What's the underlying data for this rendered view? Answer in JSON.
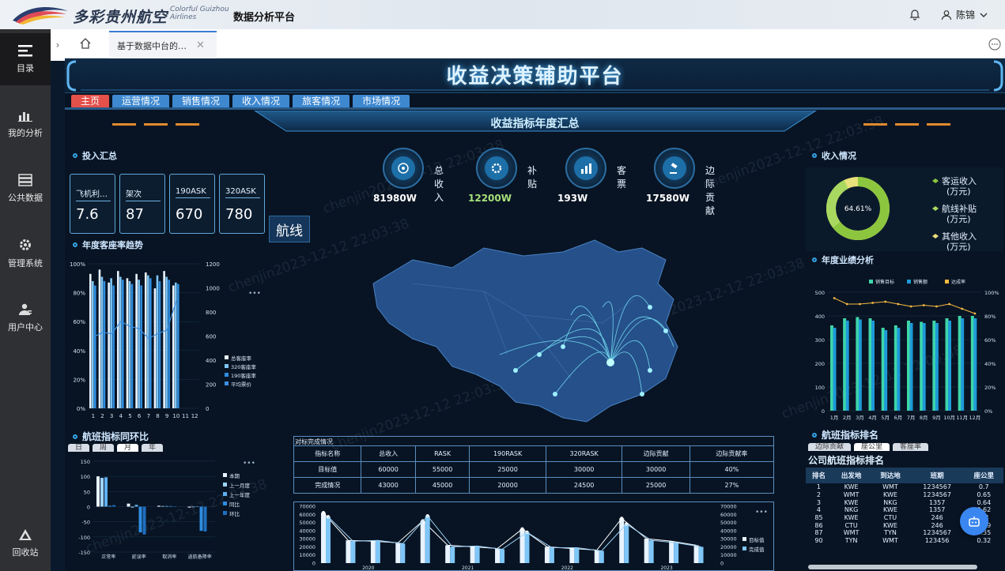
{
  "topbar": {
    "brand_cn": "多彩贵州航空",
    "brand_en_1": "Colorful Guizhou",
    "brand_en_2": "Airlines",
    "app_title": "数据分析平台",
    "user_name": "陈锦"
  },
  "sidebar": {
    "items": [
      {
        "label": "目录",
        "icon": "menu-list-icon"
      },
      {
        "label": "我的分析",
        "icon": "bar-chart-icon"
      },
      {
        "label": "公共数据",
        "icon": "database-icon"
      },
      {
        "label": "管理系统",
        "icon": "gear-icon"
      },
      {
        "label": "用户中心",
        "icon": "user-icon"
      },
      {
        "label": "回收站",
        "icon": "recycle-icon"
      }
    ]
  },
  "tabs": {
    "page_tab": "基于数据中台的…"
  },
  "dashboard": {
    "title": "收益决策辅助平台",
    "nav": [
      "主页",
      "运营情况",
      "销售情况",
      "收入情况",
      "旅客情况",
      "市场情况"
    ],
    "banner": "收益指标年度汇总",
    "watermark": "chenjin2023-12-12 22:03:38",
    "investment": {
      "title": "投入汇总",
      "cards": [
        {
          "label": "飞机利…",
          "value": "7.6"
        },
        {
          "label": "架次",
          "value": "87"
        },
        {
          "label": "190ASK",
          "value": "670"
        },
        {
          "label": "320ASK",
          "value": "780"
        }
      ]
    },
    "indicators": [
      {
        "label": "总收入",
        "value": "81980W"
      },
      {
        "label": "补贴",
        "value": "12200W"
      },
      {
        "label": "客票",
        "value": "193W"
      },
      {
        "label": "边际贡献",
        "value": "17580W"
      }
    ],
    "route_label": "航线",
    "income": {
      "title": "收入情况",
      "pct": "64.61%",
      "legend": [
        "客运收入",
        "(万元)",
        "航线补贴",
        "(万元)",
        "其他收入",
        "(万元)"
      ],
      "share": 0.6461
    },
    "load_trend": {
      "title": "年度客座率趋势",
      "legend": [
        "总客座率",
        "320客座率",
        "190客座率",
        "平均票价"
      ],
      "y_left": [
        "100%",
        "80%",
        "60%",
        "40%",
        "20%",
        "0%"
      ],
      "y_right": [
        "1200",
        "1000",
        "800",
        "600",
        "400",
        "200",
        "0"
      ],
      "x": [
        "1",
        "2",
        "3",
        "4",
        "5",
        "6",
        "7",
        "8",
        "9",
        "10",
        "11",
        "12"
      ]
    },
    "flight_yoy": {
      "title": "航班指标同环比",
      "tabs": [
        "日",
        "周",
        "月",
        "年"
      ],
      "y": [
        "150",
        "100",
        "50",
        "0",
        "-50",
        "-100",
        "-150"
      ],
      "x": [
        "正常率",
        "延误率",
        "取消率",
        "返航备降率"
      ],
      "legend": [
        "本期",
        "上一月度",
        "上一年度",
        "同比",
        "环比"
      ]
    },
    "completion": {
      "caption": "对标完成情况",
      "headers": [
        "指标名称",
        "总收入",
        "RASK",
        "190RASK",
        "320RASK",
        "边际贡献",
        "边际贡献率"
      ],
      "rows": [
        [
          "目标值",
          "60000",
          "55000",
          "25000",
          "30000",
          "30000",
          "40%"
        ],
        [
          "完成情况",
          "43000",
          "45000",
          "20000",
          "24500",
          "25000",
          "27%"
        ]
      ]
    },
    "combo": {
      "y_left": [
        "70000",
        "60000",
        "50000",
        "40000",
        "30000",
        "20000",
        "10000",
        "0"
      ],
      "y_right": [
        "70000",
        "60000",
        "50000",
        "40000",
        "30000",
        "20000",
        "10000",
        "0"
      ],
      "x": [
        "2020",
        "2021",
        "2022",
        "2023"
      ],
      "legend": [
        "目标值",
        "完成值"
      ]
    },
    "annual": {
      "title": "年度业绩分析",
      "legend": [
        "销售目标",
        "销售额",
        "达成率"
      ],
      "y_left": [
        "500",
        "400",
        "300",
        "200",
        "100",
        "0"
      ],
      "y_right": [
        "100%",
        "80%",
        "60%",
        "40%",
        "20%",
        "0%"
      ],
      "x": [
        "1月",
        "2月",
        "3月",
        "4月",
        "5月",
        "6月",
        "7月",
        "8月",
        "9月",
        "10月",
        "11月",
        "12月"
      ]
    },
    "ranking": {
      "title": "航班指标排名",
      "tabs": [
        "边际贡献",
        "座公里",
        "客座率"
      ],
      "subtitle": "公司航班指标排名",
      "headers": [
        "排名",
        "出发地",
        "到达地",
        "班期",
        "座公里"
      ],
      "rows": [
        [
          "1",
          "KWE",
          "WMT",
          "1234567",
          "0.7"
        ],
        [
          "2",
          "WMT",
          "KWE",
          "1234567",
          "0.65"
        ],
        [
          "3",
          "KWE",
          "NKG",
          "1357",
          "0.64"
        ],
        [
          "4",
          "NKG",
          "KWE",
          "1357",
          "0.62"
        ],
        [
          "85",
          "KWE",
          "CTU",
          "246",
          "0.4"
        ],
        [
          "86",
          "CTU",
          "KWE",
          "246",
          "0.39"
        ],
        [
          "87",
          "WMT",
          "TYN",
          "1234567",
          "0.35"
        ],
        [
          "90",
          "TYN",
          "WMT",
          "123456",
          "0.32"
        ]
      ]
    }
  },
  "chart_data": [
    {
      "type": "bar",
      "title": "年度客座率趋势",
      "categories": [
        "1",
        "2",
        "3",
        "4",
        "5",
        "6",
        "7",
        "8",
        "9",
        "10",
        "11",
        "12"
      ],
      "series": [
        {
          "name": "总客座率",
          "values": [
            93,
            96,
            87,
            95,
            90,
            93,
            94,
            83,
            95,
            85,
            0,
            0
          ]
        },
        {
          "name": "320客座率",
          "values": [
            88,
            91,
            90,
            91,
            88,
            89,
            92,
            92,
            91,
            87,
            0,
            0
          ]
        },
        {
          "name": "190客座率",
          "values": [
            85,
            88,
            85,
            89,
            86,
            85,
            90,
            88,
            89,
            86,
            0,
            0
          ]
        },
        {
          "name": "平均票价",
          "values": [
            590,
            630,
            620,
            720,
            680,
            660,
            580,
            620,
            650,
            890
          ]
        }
      ],
      "ylim": [
        0,
        100
      ],
      "y2lim": [
        0,
        1200
      ]
    },
    {
      "type": "bar",
      "title": "航班指标同环比",
      "categories": [
        "正常率",
        "延误率",
        "取消率",
        "返航备降率"
      ],
      "series": [
        {
          "name": "本期",
          "values": [
            100,
            10,
            3,
            -3
          ]
        },
        {
          "name": "上一月度",
          "values": [
            95,
            -3,
            2,
            -2
          ]
        },
        {
          "name": "上一年度",
          "values": [
            97,
            6,
            2,
            -1
          ]
        },
        {
          "name": "同比",
          "values": [
            3,
            -85,
            2,
            -80
          ]
        },
        {
          "name": "环比",
          "values": [
            5,
            -92,
            1,
            -82
          ]
        }
      ],
      "ylim": [
        -150,
        150
      ]
    },
    {
      "type": "bar",
      "categories": [
        "2020",
        "2021",
        "2022",
        "2023"
      ],
      "series": [
        {
          "name": "目标值",
          "values": [
            62000,
            28000,
            27000,
            25000,
            52000,
            22000,
            20000,
            18000,
            42000,
            20000,
            18000,
            16000,
            55000,
            30000,
            27000,
            22000
          ]
        },
        {
          "name": "完成值",
          "values": [
            57000,
            27000,
            28000,
            24000,
            58000,
            20000,
            21000,
            17000,
            38000,
            19000,
            19000,
            15000,
            48000,
            28000,
            25000,
            20000
          ]
        }
      ],
      "ylim": [
        0,
        70000
      ]
    },
    {
      "type": "bar",
      "title": "年度业绩分析",
      "categories": [
        "1月",
        "2月",
        "3月",
        "4月",
        "5月",
        "6月",
        "7月",
        "8月",
        "9月",
        "10月",
        "11月",
        "12月"
      ],
      "series": [
        {
          "name": "销售目标",
          "values": [
            360,
            390,
            395,
            390,
            350,
            360,
            380,
            375,
            380,
            390,
            400,
            400
          ]
        },
        {
          "name": "销售额",
          "values": [
            350,
            380,
            385,
            380,
            340,
            350,
            370,
            370,
            370,
            380,
            390,
            390
          ]
        },
        {
          "name": "达成率",
          "values": [
            95,
            90,
            90,
            91,
            92,
            90,
            88,
            89,
            88,
            90,
            86,
            82
          ]
        }
      ],
      "ylim": [
        0,
        500
      ],
      "y2lim": [
        0,
        100
      ]
    },
    {
      "type": "pie",
      "title": "收入情况",
      "categories": [
        "客运收入",
        "航线补贴",
        "其他收入"
      ],
      "values": [
        64.61,
        25,
        10.39
      ]
    }
  ]
}
